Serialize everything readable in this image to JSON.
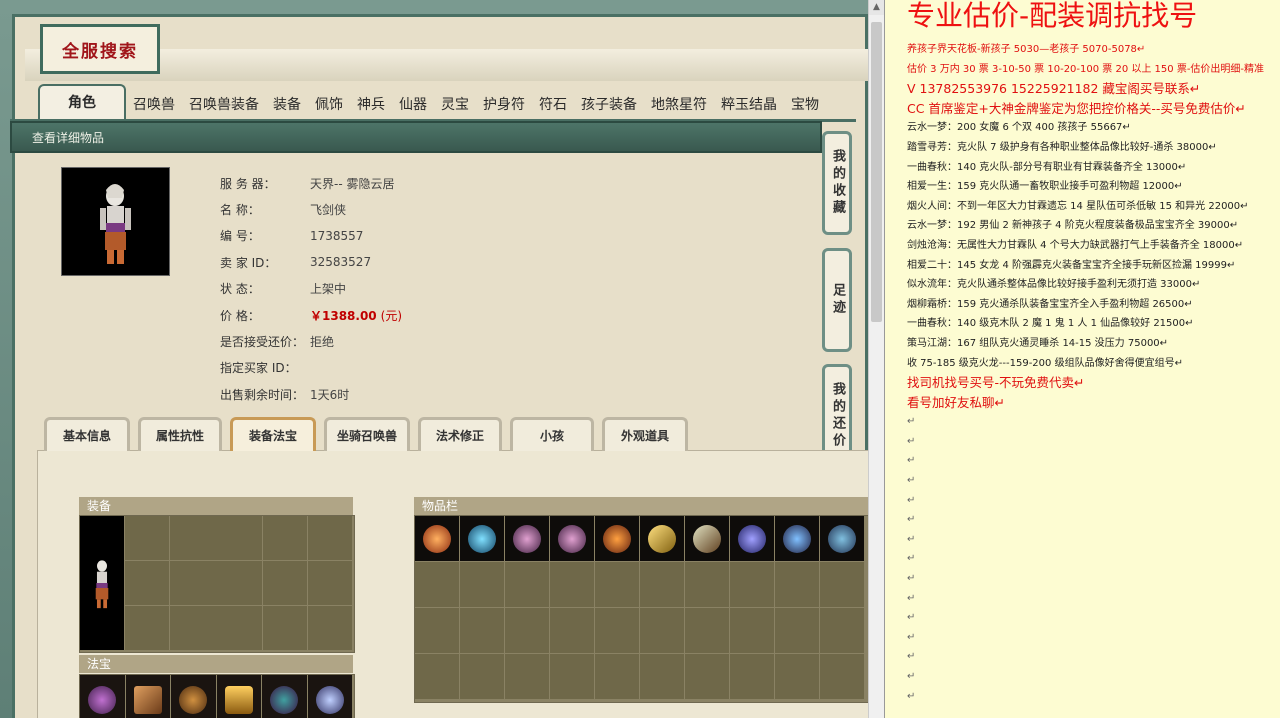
{
  "site": {
    "logo_text": "全服搜索"
  },
  "main_tabs": [
    {
      "label": "角色",
      "active": true
    },
    {
      "label": "召唤兽"
    },
    {
      "label": "召唤兽装备"
    },
    {
      "label": "装备"
    },
    {
      "label": "佩饰"
    },
    {
      "label": "神兵"
    },
    {
      "label": "仙器"
    },
    {
      "label": "灵宝"
    },
    {
      "label": "护身符"
    },
    {
      "label": "符石"
    },
    {
      "label": "孩子装备"
    },
    {
      "label": "地煞星符"
    },
    {
      "label": "粹玉结晶"
    },
    {
      "label": "宝物"
    }
  ],
  "section": {
    "title": "查看详细物品"
  },
  "side_tabs": [
    {
      "label": "我的收藏"
    },
    {
      "label": "足迹"
    },
    {
      "label": "我的还价"
    }
  ],
  "details": [
    {
      "key": "服 务 器：",
      "value": "天界-- 雾隐云居"
    },
    {
      "key": "名       称：",
      "value": "飞剑侠"
    },
    {
      "key": "编       号：",
      "value": "1738557"
    },
    {
      "key": "卖  家  ID：",
      "value": "32583527"
    },
    {
      "key": "状       态：",
      "value": "上架中"
    },
    {
      "key": "价       格：",
      "value": "￥1388.00",
      "unit": "(元)"
    },
    {
      "key": "是否接受还价：",
      "value": "拒绝"
    },
    {
      "key": "指定买家 ID：",
      "value": ""
    },
    {
      "key": "出售剩余时间：",
      "value": "1天6时"
    }
  ],
  "sub_tabs": [
    {
      "label": "基本信息",
      "w": 86
    },
    {
      "label": "属性抗性",
      "w": 84
    },
    {
      "label": "装备法宝",
      "w": 86,
      "active": true
    },
    {
      "label": "坐骑召唤兽",
      "w": 86
    },
    {
      "label": "法术修正",
      "w": 84
    },
    {
      "label": "小孩",
      "w": 84
    },
    {
      "label": "外观道具",
      "w": 86
    }
  ],
  "panels": {
    "equip": "装备",
    "fabao": "法宝",
    "items": "物品栏"
  },
  "right": {
    "title": "专业估价-配装调抗找号",
    "lines": [
      {
        "t": "养孩子界天花板-新孩子 5030—老孩子 5070-5078↵",
        "c": "red"
      },
      {
        "t": "估价 3 万内 30 票  3-10-50 票  10-20-100 票  20 以上 150 票-估价出明细-精准",
        "c": "red"
      },
      {
        "t": "V 13782553976     15225921182   藏宝阁买号联系↵",
        "c": "red big"
      },
      {
        "t": "CC 首席鉴定+大神金牌鉴定为您把控价格关--买号免费估价↵",
        "c": "red big"
      },
      {
        "t": "云水一梦：200 女魔 6 个双 400 孩孩子 55667↵",
        "c": ""
      },
      {
        "t": "踏雪寻芳：克火队 7 级护身有各种职业整体品像比较好-通杀 38000↵",
        "c": ""
      },
      {
        "t": "一曲春秋：140 克火队-部分号有职业有甘霖装备齐全 13000↵",
        "c": ""
      },
      {
        "t": "相爱一生：159 克火队通一畜牧职业接手可盈利物超 12000↵",
        "c": ""
      },
      {
        "t": "烟火人间：不到一年区大力甘霖遗忘 14 星队伍可杀低敏 15 和异光 22000↵",
        "c": ""
      },
      {
        "t": "云水一梦：192 男仙 2 新神孩子 4 阶克火程度装备极品宝宝齐全 39000↵",
        "c": ""
      },
      {
        "t": "剑烛沧海：无属性大力甘霖队 4 个号大力缺武器打气上手装备齐全 18000↵",
        "c": ""
      },
      {
        "t": "相爱二十：145 女龙 4 阶强霹克火装备宝宝齐全接手玩新区捡漏 19999↵",
        "c": ""
      },
      {
        "t": "似水流年：克火队通杀整体品像比较好接手盈利无须打造 33000↵",
        "c": ""
      },
      {
        "t": "烟柳霜桥：159 克火通杀队装备宝宝齐全入手盈利物超 26500↵",
        "c": ""
      },
      {
        "t": "一曲春秋：140 级克木队 2 魔 1 鬼 1 人 1 仙品像较好 21500↵",
        "c": ""
      },
      {
        "t": "策马江湖：167 组队克火通灵睡杀 14-15 没压力 75000↵",
        "c": ""
      },
      {
        "t": "收 75-185 级克火龙---159-200 级组队品像好舍得便宜组号↵",
        "c": ""
      },
      {
        "t": "找司机找号买号-不玩免费代卖↵",
        "c": "red big"
      },
      {
        "t": "看号加好友私聊↵",
        "c": "red big"
      }
    ],
    "blank_mark": "↵"
  },
  "colors": {
    "frame": "#4a7064",
    "price": "#c00000",
    "right_bg": "#fdfcd2",
    "right_red": "#ee1111"
  }
}
